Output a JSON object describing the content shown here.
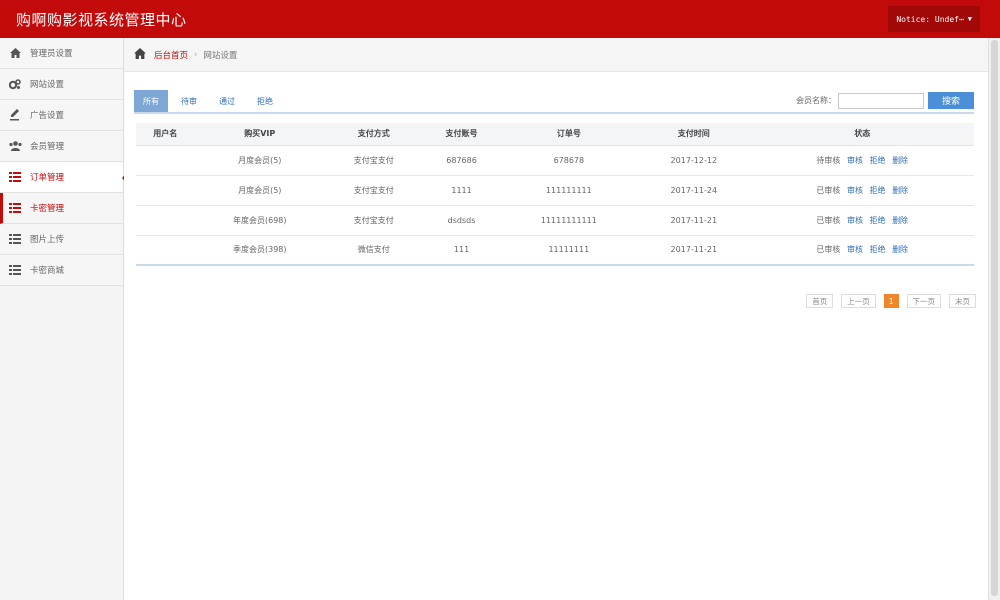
{
  "header": {
    "brand": "购啊购影视系统管理中心",
    "notice": "Notice: Undef⋯"
  },
  "sidebar": {
    "items": [
      {
        "label": "管理员设置",
        "icon": "home-icon"
      },
      {
        "label": "网站设置",
        "icon": "gears-icon"
      },
      {
        "label": "广告设置",
        "icon": "pen-icon"
      },
      {
        "label": "会员管理",
        "icon": "users-icon"
      },
      {
        "label": "订单管理",
        "icon": "list-icon"
      },
      {
        "label": "卡密管理",
        "icon": "list-icon"
      },
      {
        "label": "图片上传",
        "icon": "list-icon"
      },
      {
        "label": "卡密商城",
        "icon": "list-icon"
      }
    ]
  },
  "breadcrumb": {
    "home": "后台首页",
    "separator": "›",
    "current": "网站设置"
  },
  "tabs": [
    "所有",
    "待审",
    "通过",
    "拒绝"
  ],
  "search": {
    "label": "会员名称：",
    "value": "",
    "placeholder": "",
    "button": "搜索"
  },
  "table": {
    "columns": [
      "用户名",
      "购买VIP",
      "支付方式",
      "支付账号",
      "订单号",
      "支付时间",
      "状态"
    ],
    "rows": [
      {
        "username": "",
        "vip": "月度会员(5)",
        "method": "支付宝支付",
        "account": "687686",
        "order": "678678",
        "time": "2017-12-12",
        "status": "待审核",
        "ops": [
          "审核",
          "拒绝",
          "删除"
        ]
      },
      {
        "username": "",
        "vip": "月度会员(5)",
        "method": "支付宝支付",
        "account": "1111",
        "order": "111111111",
        "time": "2017-11-24",
        "status": "已审核",
        "ops": [
          "审核",
          "拒绝",
          "删除"
        ]
      },
      {
        "username": "",
        "vip": "年度会员(698)",
        "method": "支付宝支付",
        "account": "dsdsds",
        "order": "11111111111",
        "time": "2017-11-21",
        "status": "已审核",
        "ops": [
          "审核",
          "拒绝",
          "删除"
        ]
      },
      {
        "username": "",
        "vip": "季度会员(398)",
        "method": "微信支付",
        "account": "111",
        "order": "11111111",
        "time": "2017-11-21",
        "status": "已审核",
        "ops": [
          "审核",
          "拒绝",
          "删除"
        ]
      }
    ]
  },
  "pagination": {
    "first": "首页",
    "prev": "上一页",
    "current": "1",
    "next": "下一页",
    "last": "末页"
  },
  "colors": {
    "brand_red": "#c20a0a",
    "tab_active": "#7fa7d5",
    "link_blue": "#2f6fb6",
    "page_current": "#f0852a"
  }
}
